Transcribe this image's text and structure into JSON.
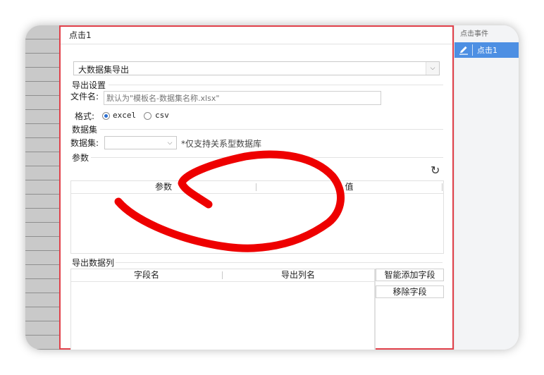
{
  "dialog": {
    "title": "点击1",
    "action_select": "大数据集导出",
    "export_settings": {
      "section_label": "导出设置",
      "filename_label": "文件名:",
      "filename_placeholder": "默认为\"模板名-数据集名称.xlsx\"",
      "format_label": "格式:",
      "formats": [
        {
          "label": "excel",
          "checked": true
        },
        {
          "label": "csv",
          "checked": false
        }
      ]
    },
    "dataset": {
      "section_label": "数据集",
      "field_label": "数据集:",
      "selected": "",
      "hint": "*仅支持关系型数据库"
    },
    "params": {
      "section_label": "参数",
      "refresh_icon": "refresh-icon",
      "columns": [
        "参数",
        "值"
      ]
    },
    "export_columns": {
      "section_label": "导出数据列",
      "columns": [
        "字段名",
        "导出列名"
      ],
      "smart_add_button": "智能添加字段",
      "remove_button": "移除字段"
    }
  },
  "events_panel": {
    "title": "点击事件",
    "items": [
      {
        "label": "点击1",
        "icon": "edit-icon",
        "selected": true
      }
    ]
  },
  "colors": {
    "dialog_border": "#e1404a",
    "selected_event": "#4d8fe3",
    "annotation_stroke": "#ee0000"
  }
}
